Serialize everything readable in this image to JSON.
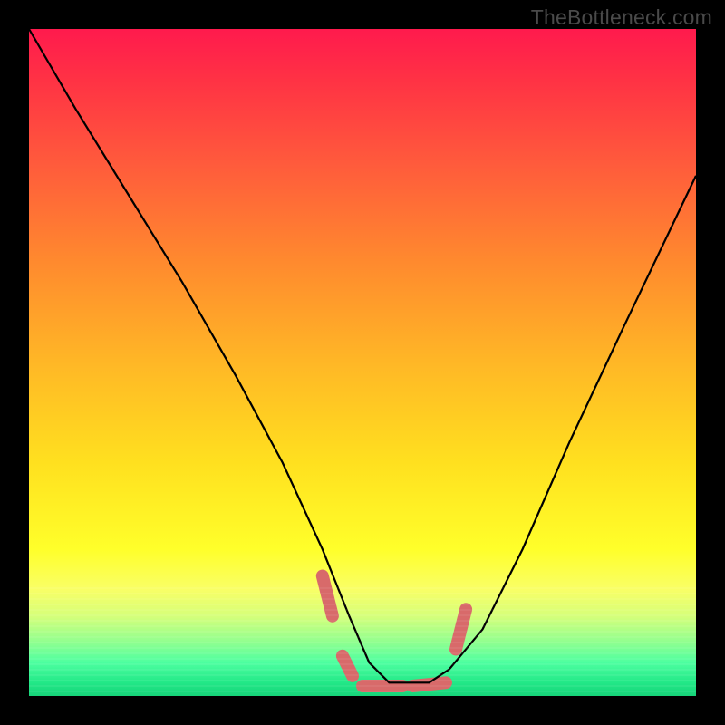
{
  "attribution": "TheBottleneck.com",
  "colors": {
    "gradient_top": "#ff1a4d",
    "gradient_bottom": "#17d47a",
    "dash_color": "#d86a6a",
    "line_color": "#000000",
    "frame_color": "#000000"
  },
  "chart_data": {
    "type": "line",
    "title": "",
    "xlabel": "",
    "ylabel": "",
    "xlim": [
      0,
      100
    ],
    "ylim": [
      0,
      100
    ],
    "x": [
      0,
      7,
      15,
      23,
      31,
      38,
      44,
      48,
      51,
      54,
      57,
      60,
      63,
      68,
      74,
      81,
      89,
      100
    ],
    "values": [
      100,
      88,
      75,
      62,
      48,
      35,
      22,
      12,
      5,
      2,
      2,
      2,
      4,
      10,
      22,
      38,
      55,
      78
    ],
    "dash_segments": [
      {
        "x": [
          44.0,
          45.5
        ],
        "y": [
          18.0,
          12.0
        ]
      },
      {
        "x": [
          47.0,
          48.5
        ],
        "y": [
          6.0,
          3.0
        ]
      },
      {
        "x": [
          50.0,
          56.0
        ],
        "y": [
          1.5,
          1.5
        ]
      },
      {
        "x": [
          57.5,
          62.5
        ],
        "y": [
          1.5,
          2.0
        ]
      },
      {
        "x": [
          64.0,
          65.5
        ],
        "y": [
          7.0,
          13.0
        ]
      }
    ]
  }
}
